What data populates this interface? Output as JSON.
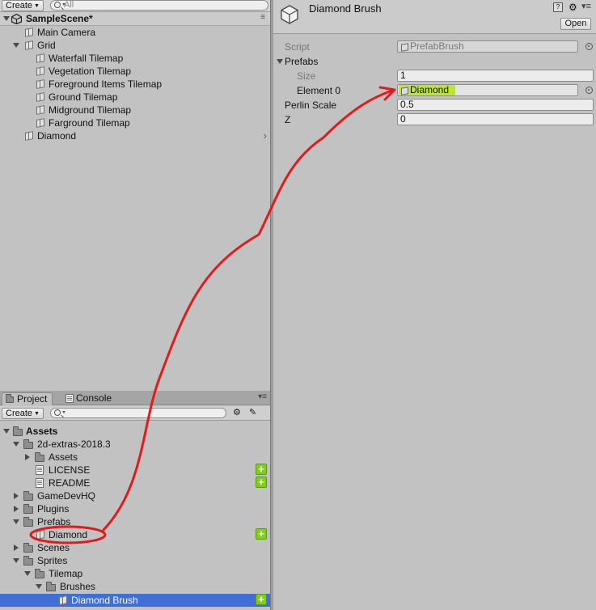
{
  "hierarchy": {
    "create_label": "Create",
    "search_placeholder": "All",
    "scene_name": "SampleScene*",
    "items": [
      {
        "label": "Main Camera"
      },
      {
        "label": "Grid"
      },
      {
        "label": "Waterfall Tilemap"
      },
      {
        "label": "Vegetation Tilemap"
      },
      {
        "label": "Foreground Items Tilemap"
      },
      {
        "label": "Ground Tilemap"
      },
      {
        "label": "Midground Tilemap"
      },
      {
        "label": "Farground Tilemap"
      },
      {
        "label": "Diamond"
      }
    ]
  },
  "project": {
    "tabs": [
      {
        "label": "Project"
      },
      {
        "label": "Console"
      }
    ],
    "create_label": "Create",
    "tree": [
      {
        "label": "Assets"
      },
      {
        "label": "2d-extras-2018.3"
      },
      {
        "label": "Assets"
      },
      {
        "label": "LICENSE"
      },
      {
        "label": "README"
      },
      {
        "label": "GameDevHQ"
      },
      {
        "label": "Plugins"
      },
      {
        "label": "Prefabs"
      },
      {
        "label": "Diamond"
      },
      {
        "label": "Scenes"
      },
      {
        "label": "Sprites"
      },
      {
        "label": "Tilemap"
      },
      {
        "label": "Brushes"
      },
      {
        "label": "Diamond Brush"
      }
    ]
  },
  "inspector": {
    "title": "Diamond Brush",
    "open_label": "Open",
    "props": {
      "script_label": "Script",
      "script_value": "PrefabBrush",
      "prefabs_label": "Prefabs",
      "size_label": "Size",
      "size_value": "1",
      "element0_label": "Element 0",
      "element0_value": "Diamond",
      "perlin_label": "Perlin Scale",
      "perlin_value": "0.5",
      "z_label": "Z",
      "z_value": "0"
    }
  },
  "colors": {
    "panel_bg": "#c2c2c2",
    "selection_blue": "#3e6ed6",
    "add_green": "#7dcf1a",
    "highlight_green": "#b6e41a",
    "annotation_red": "#e01b1b"
  }
}
